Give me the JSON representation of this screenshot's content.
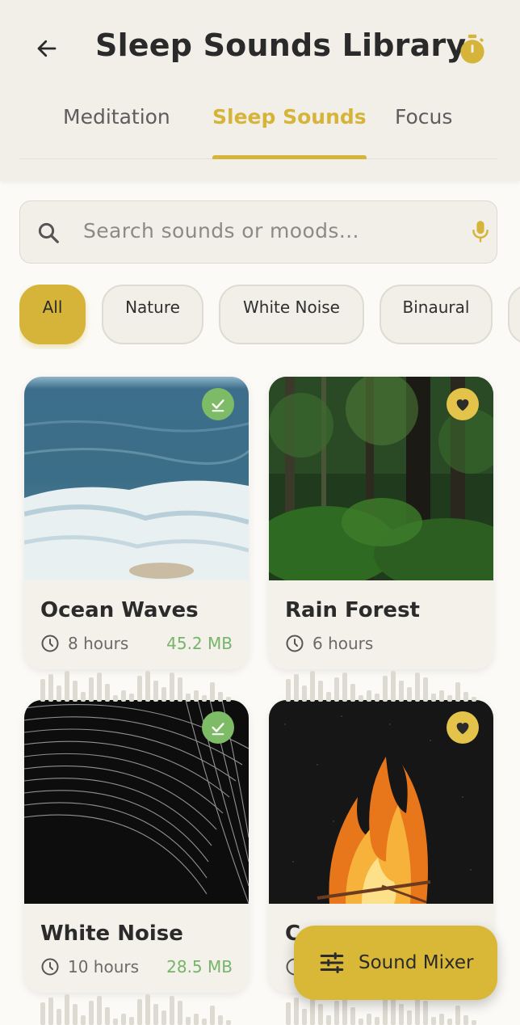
{
  "header": {
    "title": "Sleep Sounds Library",
    "back_icon": "arrow-left-icon",
    "timer_icon": "stopwatch-icon"
  },
  "tabs": [
    {
      "label": "Meditation",
      "active": false
    },
    {
      "label": "Sleep Sounds",
      "active": true
    },
    {
      "label": "Focus",
      "active": false
    }
  ],
  "search": {
    "placeholder": "Search sounds or moods...",
    "search_icon": "search-icon",
    "mic_icon": "mic-icon"
  },
  "chips": [
    {
      "label": "All",
      "active": true
    },
    {
      "label": "Nature",
      "active": false
    },
    {
      "label": "White Noise",
      "active": false
    },
    {
      "label": "Binaural",
      "active": false
    }
  ],
  "cards": [
    {
      "name": "Ocean Waves",
      "duration": "8 hours",
      "size": "45.2 MB",
      "badge": "check-icon"
    },
    {
      "name": "Rain Forest",
      "duration": "6 hours",
      "size": "",
      "badge": "heart-icon"
    },
    {
      "name": "White Noise",
      "duration": "10 hours",
      "size": "28.5 MB",
      "badge": "check-icon"
    },
    {
      "name": "C",
      "duration": "",
      "size": "",
      "badge": "heart-icon"
    }
  ],
  "fab": {
    "label": "Sound Mixer",
    "icon": "sliders-icon"
  },
  "colors": {
    "accent": "#d6b43a",
    "success": "#78b36a",
    "surface": "#f1efe8",
    "background": "#fbfaf6"
  }
}
